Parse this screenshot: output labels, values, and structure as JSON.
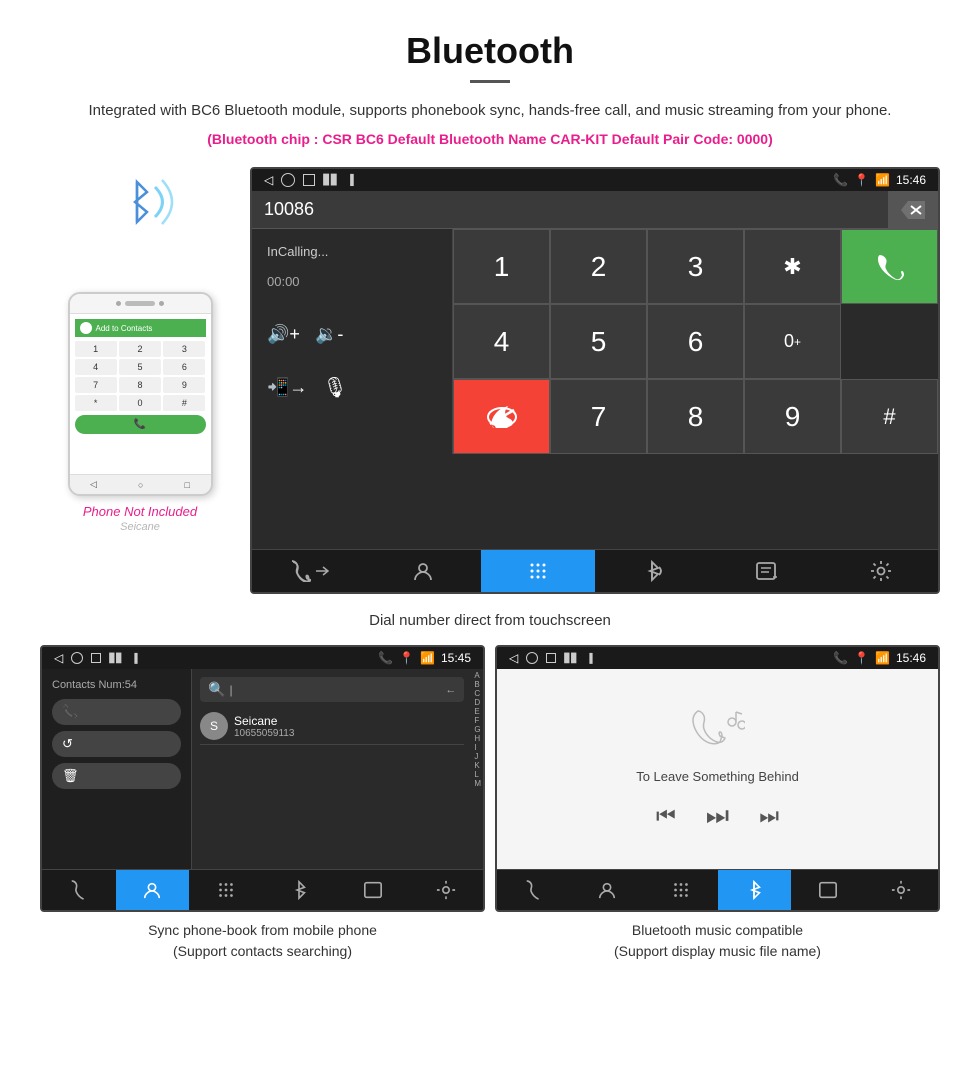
{
  "header": {
    "title": "Bluetooth",
    "description": "Integrated with BC6 Bluetooth module, supports phonebook sync, hands-free call, and music streaming from your phone.",
    "info_line": "(Bluetooth chip : CSR BC6    Default Bluetooth Name CAR-KIT    Default Pair Code: 0000)"
  },
  "phone_mockup": {
    "header_text": "Add to Contacts",
    "keys": [
      "1",
      "2",
      "3",
      "4",
      "5",
      "6",
      "7",
      "8",
      "9",
      "*",
      "0",
      "#"
    ],
    "call_btn": "📞",
    "not_included_label": "Phone Not Included",
    "watermark": "Seicane"
  },
  "main_screen": {
    "status_bar": {
      "time": "15:46",
      "left_icons": [
        "◁",
        "○",
        "□"
      ],
      "right_icons": [
        "📞",
        "📍",
        "📶"
      ]
    },
    "number_display": "10086",
    "calling_label": "InCalling...",
    "call_time": "00:00",
    "dialpad": {
      "keys": [
        "1",
        "2",
        "3",
        "*",
        "4",
        "5",
        "6",
        "0+",
        "7",
        "8",
        "9",
        "#"
      ]
    },
    "nav_items": [
      {
        "icon": "📞",
        "label": "phone",
        "active": false
      },
      {
        "icon": "👤",
        "label": "contacts",
        "active": false
      },
      {
        "icon": "⠿",
        "label": "dialpad",
        "active": true
      },
      {
        "icon": "🎵",
        "label": "bluetooth-music",
        "active": false
      },
      {
        "icon": "📋",
        "label": "call-log",
        "active": false
      },
      {
        "icon": "⚙",
        "label": "settings",
        "active": false
      }
    ]
  },
  "main_caption": "Dial number direct from touchscreen",
  "bottom_left_screen": {
    "status_bar": {
      "time": "15:45"
    },
    "contacts_num": "Contacts Num:54",
    "contact_name": "Seicane",
    "contact_phone": "10655059113",
    "alpha_list": [
      "A",
      "B",
      "C",
      "D",
      "E",
      "F",
      "G",
      "H",
      "I",
      "J",
      "K",
      "L",
      "M"
    ],
    "nav_active": "contacts",
    "caption_line1": "Sync phone-book from mobile phone",
    "caption_line2": "(Support contacts searching)"
  },
  "bottom_right_screen": {
    "status_bar": {
      "time": "15:46"
    },
    "song_title": "To Leave Something Behind",
    "nav_active": "bluetooth-music",
    "caption_line1": "Bluetooth music compatible",
    "caption_line2": "(Support display music file name)"
  },
  "colors": {
    "accent_magenta": "#e91e8c",
    "accent_blue": "#2196F3",
    "accent_green": "#4CAF50",
    "accent_red": "#f44336",
    "dark_bg": "#2a2a2a",
    "status_bar_bg": "#1a1a1a"
  }
}
